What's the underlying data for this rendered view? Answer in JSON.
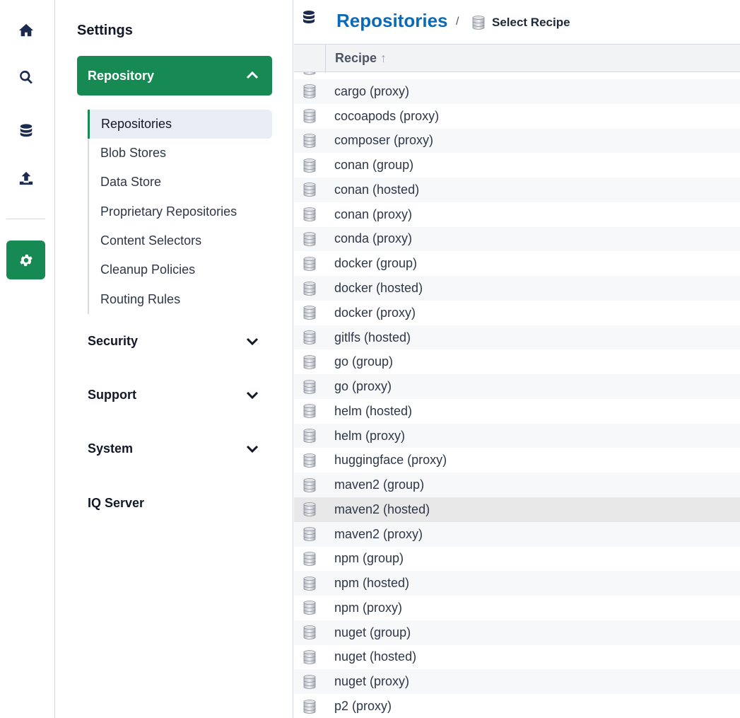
{
  "rail": {
    "items": [
      {
        "name": "home"
      },
      {
        "name": "search"
      },
      {
        "name": "database"
      },
      {
        "name": "upload"
      },
      {
        "name": "settings",
        "active": true
      }
    ]
  },
  "sidebar": {
    "title": "Settings",
    "open_group": "Repository",
    "sub_items": [
      {
        "label": "Repositories",
        "active": true
      },
      {
        "label": "Blob Stores"
      },
      {
        "label": "Data Store"
      },
      {
        "label": "Proprietary Repositories"
      },
      {
        "label": "Content Selectors"
      },
      {
        "label": "Cleanup Policies"
      },
      {
        "label": "Routing Rules"
      }
    ],
    "groups": [
      {
        "label": "Security"
      },
      {
        "label": "Support"
      },
      {
        "label": "System"
      }
    ],
    "iq_server": "IQ Server"
  },
  "breadcrumb": {
    "title": "Repositories",
    "separator": "/",
    "current": "Select Recipe"
  },
  "table": {
    "column": "Recipe",
    "sort_indicator": "↑",
    "rows": [
      "cargo (proxy)",
      "cocoapods (proxy)",
      "composer (proxy)",
      "conan (group)",
      "conan (hosted)",
      "conan (proxy)",
      "conda (proxy)",
      "docker (group)",
      "docker (hosted)",
      "docker (proxy)",
      "gitlfs (hosted)",
      "go (group)",
      "go (proxy)",
      "helm (hosted)",
      "helm (proxy)",
      "huggingface (proxy)",
      "maven2 (group)",
      "maven2 (hosted)",
      "maven2 (proxy)",
      "npm (group)",
      "npm (hosted)",
      "npm (proxy)",
      "nuget (group)",
      "nuget (hosted)",
      "nuget (proxy)",
      "p2 (proxy)"
    ],
    "highlighted_row": "maven2 (hosted)"
  },
  "colors": {
    "accent": "#178a54",
    "title_blue": "#0b6ab8"
  }
}
